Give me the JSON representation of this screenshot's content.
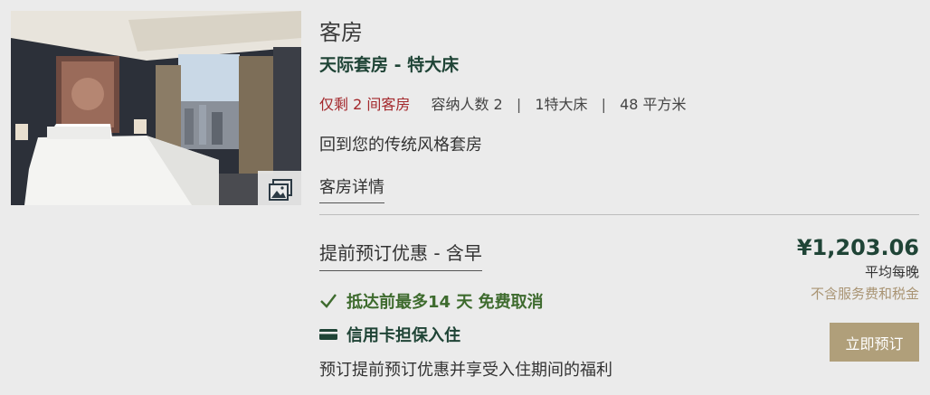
{
  "room": {
    "type_label": "客房",
    "name": "天际套房 - 特大床",
    "availability": "仅剩 2 间客房",
    "meta": [
      "容纳人数 2",
      "1特大床",
      "48 平方米"
    ],
    "meta_separator": "|",
    "description": "回到您的传统风格套房",
    "details_link": "客房详情"
  },
  "rate": {
    "name": "提前预订优惠 - 含早",
    "cancellation": "抵达前最多14 天 免费取消",
    "guarantee": "信用卡担保入住",
    "perk": "预订提前预订优惠并享受入住期间的福利",
    "price": "¥1,203.06",
    "price_unit": "平均每晚",
    "tax_note": "不含服务费和税金",
    "book_label": "立即预订"
  },
  "icons": {
    "gallery": "gallery-icon",
    "check": "check-icon",
    "card": "credit-card-icon"
  },
  "colors": {
    "brand_green": "#1f4436",
    "cancel_green": "#3e6b2e",
    "alert_red": "#a3272b",
    "gold": "#b09f7a",
    "background": "#ebebeb"
  }
}
